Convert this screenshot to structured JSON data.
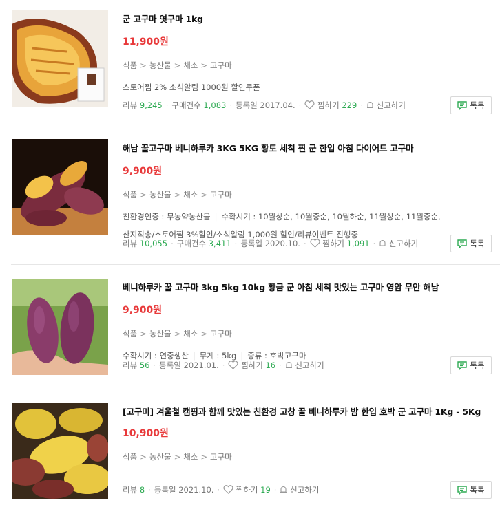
{
  "labels": {
    "review": "리뷰",
    "purchase": "구매건수",
    "registered": "등록일",
    "wish": "찜하기",
    "report": "신고하기",
    "talk": "톡톡"
  },
  "products": [
    {
      "title": "군 고구마 엿구마 1kg",
      "price": "11,900원",
      "categories": [
        "식품",
        "농산물",
        "채소",
        "고구마"
      ],
      "extra": "스토어찜 2% 소식알림 1000원 할인쿠폰",
      "reviews": "9,245",
      "purchases": "1,083",
      "date": "2017.04.",
      "wishes": "229"
    },
    {
      "title": "해남 꿀고구마 베니하루카 3KG 5KG 황토 세척 찐 군 한입 아침 다이어트 고구마",
      "price": "9,900원",
      "categories": [
        "식품",
        "농산물",
        "채소",
        "고구마"
      ],
      "attrs": [
        "친환경인증 : 무농약농산물",
        "수확시기 : 10월상순, 10월중순, 10월하순, 11월상순, 11월중순,"
      ],
      "extra": "산지직송/스토어찜 3%할인/소식알림 1,000원 할인/리뷰이벤트 진행중",
      "reviews": "10,055",
      "purchases": "3,411",
      "date": "2020.10.",
      "wishes": "1,091"
    },
    {
      "title": "베니하루카 꿀 고구마 3kg 5kg 10kg 황금 군 아침 세척 맛있는 고구마 영암 무안 해남",
      "price": "9,900원",
      "categories": [
        "식품",
        "농산물",
        "채소",
        "고구마"
      ],
      "attrs": [
        "수확시기 : 연중생산",
        "무게 : 5kg",
        "종류 : 호박고구마"
      ],
      "reviews": "56",
      "date": "2021.01.",
      "wishes": "16"
    },
    {
      "title": "[고구미] 겨울철 캠핑과 함께 맛있는 친환경 고창 꿀 베니하루카 밤 한입 호박 군 고구마 1Kg - 5Kg",
      "price": "10,900원",
      "categories": [
        "식품",
        "농산물",
        "채소",
        "고구마"
      ],
      "reviews": "8",
      "date": "2021.10.",
      "wishes": "19"
    }
  ]
}
